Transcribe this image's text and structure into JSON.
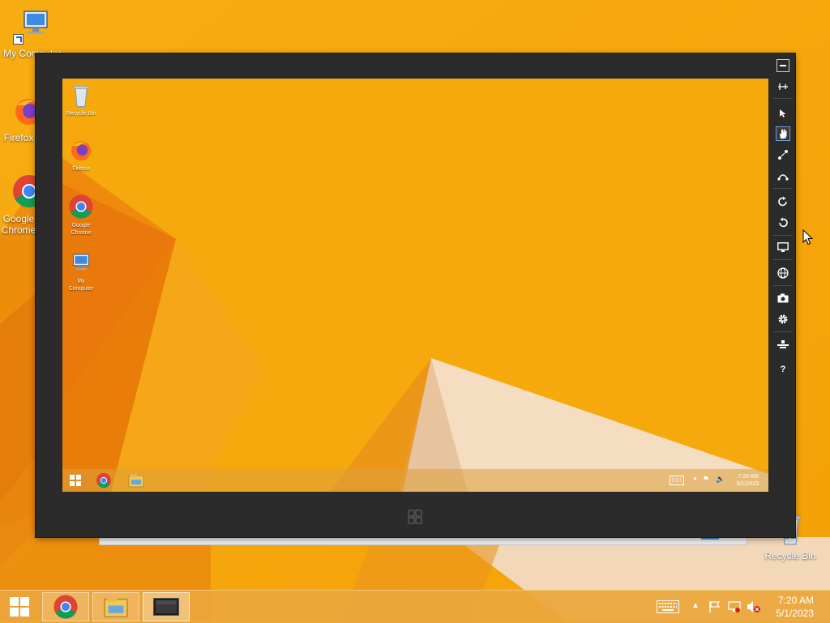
{
  "host": {
    "desktop_icons": [
      {
        "label": "My Computer",
        "icon": "computer-icon"
      },
      {
        "label": "Firefox",
        "icon": "firefox-icon"
      },
      {
        "label": "Google Chrome",
        "icon": "chrome-icon"
      },
      {
        "label": "Recycle Bin",
        "icon": "recycle-bin-icon"
      }
    ],
    "taskbar": {
      "apps": [
        {
          "name": "start",
          "icon": "windows-start-icon"
        },
        {
          "name": "chrome",
          "icon": "chrome-icon"
        },
        {
          "name": "file-explorer",
          "icon": "file-explorer-icon"
        },
        {
          "name": "remote-desktop",
          "icon": "remote-screen-icon"
        }
      ],
      "tray_icons": [
        "keyboard-icon",
        "show-hidden-icon",
        "action-center-flag-icon",
        "network-icon",
        "volume-muted-icon"
      ],
      "time": "7:20 AM",
      "date": "5/1/2023"
    }
  },
  "remote": {
    "toolbar_tools": [
      {
        "name": "minimize",
        "icon": "minimize-icon"
      },
      {
        "name": "pin",
        "icon": "pin-icon"
      },
      {
        "name": "pointer",
        "icon": "pointer-icon"
      },
      {
        "name": "hand",
        "icon": "hand-icon",
        "selected": true
      },
      {
        "name": "pinch",
        "icon": "pinch-icon"
      },
      {
        "name": "swipe",
        "icon": "swipe-icon"
      },
      {
        "name": "rotate-right",
        "icon": "rotate-clockwise-icon"
      },
      {
        "name": "rotate-left",
        "icon": "rotate-counterclockwise-icon"
      },
      {
        "name": "resolution",
        "icon": "monitor-icon"
      },
      {
        "name": "network",
        "icon": "globe-icon"
      },
      {
        "name": "screenshot",
        "icon": "camera-icon"
      },
      {
        "name": "settings",
        "icon": "gear-icon"
      },
      {
        "name": "share",
        "icon": "share-icon"
      },
      {
        "name": "help",
        "icon": "help-icon",
        "glyph": "?"
      }
    ],
    "desktop_icons": [
      {
        "label": "Recycle Bin",
        "icon": "recycle-bin-icon"
      },
      {
        "label": "Firefox",
        "icon": "firefox-icon"
      },
      {
        "label": "Google Chrome",
        "icon": "chrome-icon"
      },
      {
        "label": "My Computer",
        "icon": "computer-icon"
      }
    ],
    "taskbar": {
      "apps": [
        "windows-start-icon",
        "chrome-icon",
        "file-explorer-icon"
      ],
      "tray_icons": [
        "keyboard-icon",
        "show-hidden-icon",
        "action-center-flag-icon",
        "volume-icon"
      ],
      "time": "7:20 AM",
      "date": "5/1/2023"
    }
  },
  "colors": {
    "wallpaper": "#f6a90a",
    "shard_dark": "#e2740a",
    "shard_light": "#f5dfc4",
    "window_chrome": "#2b2b2b",
    "selected_outline": "#6fa0d6"
  }
}
